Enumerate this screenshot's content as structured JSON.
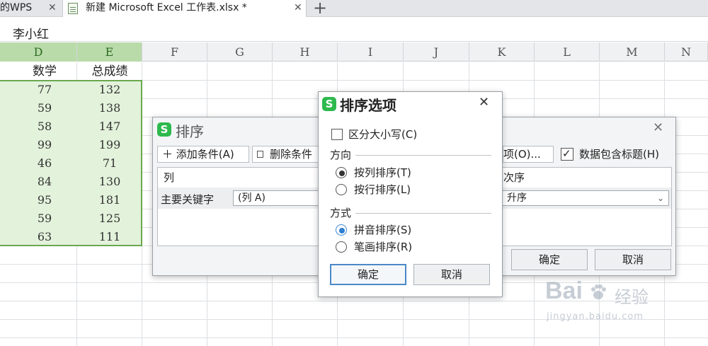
{
  "tabs": [
    {
      "label": "的WPS",
      "close": "✕"
    },
    {
      "label": "新建 Microsoft Excel 工作表.xlsx *",
      "close": "✕"
    }
  ],
  "new_tab_symbol": "+",
  "formula_bar": {
    "value": "李小红"
  },
  "columns": [
    "D",
    "E",
    "F",
    "G",
    "H",
    "I",
    "J",
    "K",
    "L",
    "M",
    "N"
  ],
  "table": {
    "headers": [
      "数学",
      "总成绩"
    ],
    "rows": [
      [
        "77",
        "132"
      ],
      [
        "59",
        "138"
      ],
      [
        "58",
        "147"
      ],
      [
        "99",
        "199"
      ],
      [
        "46",
        "71"
      ],
      [
        "84",
        "130"
      ],
      [
        "95",
        "181"
      ],
      [
        "59",
        "125"
      ],
      [
        "63",
        "111"
      ]
    ]
  },
  "sort_dialog": {
    "title": "排序",
    "close": "✕",
    "add_condition": "＋  添加条件(A)",
    "delete_condition": "删除条件",
    "options_button": "项(O)...",
    "has_header_label": "数据包含标题(H)",
    "has_header_checked": true,
    "col_header": "列",
    "order_header": "次序",
    "main_key_label": "主要关键字",
    "main_key_value": "(列 A)",
    "order_value": "升序",
    "ok": "确定",
    "cancel": "取消"
  },
  "options_dialog": {
    "title": "排序选项",
    "close": "✕",
    "case_sensitive_label": "区分大小写(C)",
    "case_sensitive_checked": false,
    "direction_label": "方向",
    "direction_options": [
      "按列排序(T)",
      "按行排序(L)"
    ],
    "direction_selected": 0,
    "method_label": "方式",
    "method_options": [
      "拼音排序(S)",
      "笔画排序(R)"
    ],
    "method_selected": 0,
    "ok": "确定",
    "cancel": "取消"
  },
  "colors": {
    "selection": "#e3f2db",
    "selection_border": "#6aa84f",
    "wps_green": "#2db94d",
    "accent_blue": "#2e7fd3"
  },
  "watermark": {
    "brand": "Bai",
    "brand_cn": "经验",
    "url": "jingyan.baidu.com"
  }
}
